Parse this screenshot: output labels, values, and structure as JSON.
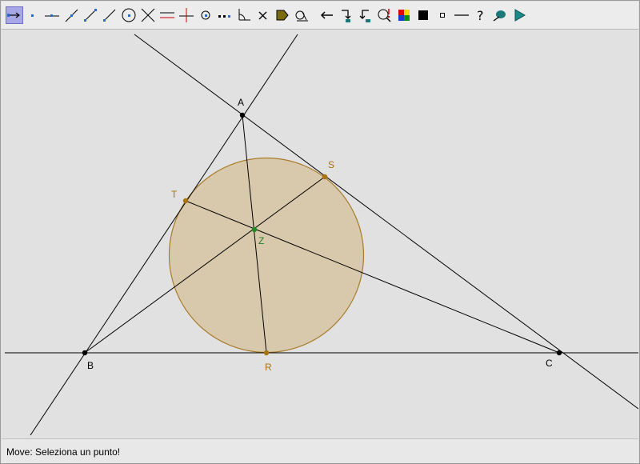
{
  "colors": {
    "line": "#000000",
    "circle_stroke": "#a87c2a",
    "circle_fill": "#d8c9ac",
    "tangent_point": "#a8730d",
    "vertex_point": "#000000",
    "center_point": "#1f8a1f",
    "center_label": "#2a7a2a",
    "tangent_label": "#a8730d"
  },
  "toolbar": {
    "tools": [
      {
        "name": "move-tool-icon",
        "active": true
      },
      {
        "name": "point-tool-icon",
        "active": false
      },
      {
        "name": "line-tool-icon",
        "active": false
      },
      {
        "name": "segment-tool-icon",
        "active": false
      },
      {
        "name": "ray-tool-icon",
        "active": false
      },
      {
        "name": "vector-tool-icon",
        "active": false
      },
      {
        "name": "circle-tool-icon",
        "active": false
      },
      {
        "name": "intersection-tool-icon",
        "active": false
      },
      {
        "name": "parallel-tool-icon",
        "active": false
      },
      {
        "name": "perpendicular-tool-icon",
        "active": false
      },
      {
        "name": "midpoint-tool-icon",
        "active": false
      },
      {
        "name": "locus-tool-icon",
        "active": false
      },
      {
        "name": "angle-tool-icon",
        "active": false
      },
      {
        "name": "delete-tool-icon",
        "active": false
      },
      {
        "name": "polygon-tool-icon",
        "active": false
      },
      {
        "name": "measure-tool-icon",
        "active": false
      },
      {
        "name": "undo-icon",
        "active": false
      },
      {
        "name": "macro-icon",
        "active": false
      },
      {
        "name": "macro-run-icon",
        "active": false
      },
      {
        "name": "zoom-icon",
        "active": false
      },
      {
        "name": "color-palette-icon",
        "active": false
      },
      {
        "name": "filled-square-icon",
        "active": false
      },
      {
        "name": "small-square-icon",
        "active": false
      },
      {
        "name": "line-style-icon",
        "active": false
      },
      {
        "name": "help-icon",
        "active": false
      },
      {
        "name": "hide-tool-icon",
        "active": false
      },
      {
        "name": "play-icon",
        "active": false
      }
    ]
  },
  "geometry": {
    "points": [
      {
        "id": "A",
        "label": "A",
        "kind": "vertex"
      },
      {
        "id": "B",
        "label": "B",
        "kind": "vertex"
      },
      {
        "id": "C",
        "label": "C",
        "kind": "vertex"
      },
      {
        "id": "Z",
        "label": "Z",
        "kind": "center"
      },
      {
        "id": "T",
        "label": "T",
        "kind": "tangent"
      },
      {
        "id": "S",
        "label": "S",
        "kind": "tangent"
      },
      {
        "id": "R",
        "label": "R",
        "kind": "tangent"
      }
    ]
  },
  "status": {
    "message": "Move: Seleziona un punto!"
  }
}
